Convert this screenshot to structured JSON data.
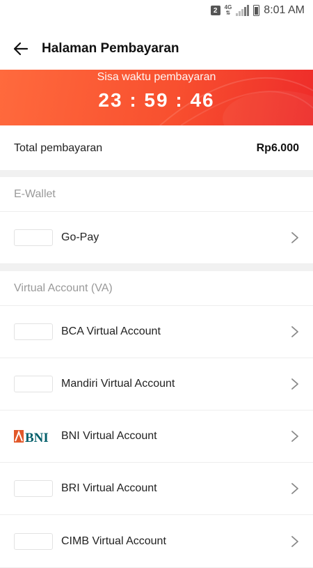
{
  "status_bar": {
    "sim_slot": "2",
    "network": "4G",
    "time": "8:01 AM"
  },
  "header": {
    "title": "Halaman Pembayaran",
    "back_icon": "arrow-left-icon"
  },
  "timer": {
    "label": "Sisa waktu pembayaran",
    "value": "23 : 59 : 46"
  },
  "total": {
    "label": "Total pembayaran",
    "amount": "Rp6.000"
  },
  "sections": [
    {
      "title": "E-Wallet",
      "items": [
        {
          "label": "Go-Pay",
          "logo": "gopay-logo"
        }
      ]
    },
    {
      "title": "Virtual Account (VA)",
      "items": [
        {
          "label": "BCA Virtual Account",
          "logo": "bca-logo"
        },
        {
          "label": "Mandiri Virtual Account",
          "logo": "mandiri-logo"
        },
        {
          "label": "BNI Virtual Account",
          "logo": "bni-logo",
          "logo_text": "BNI"
        },
        {
          "label": "BRI Virtual Account",
          "logo": "bri-logo"
        },
        {
          "label": "CIMB Virtual Account",
          "logo": "cimb-logo"
        }
      ]
    }
  ],
  "colors": {
    "banner_start": "#ff6a3d",
    "banner_end": "#ee2c2a",
    "bni_orange": "#e2582a",
    "bni_teal": "#005e6a"
  }
}
